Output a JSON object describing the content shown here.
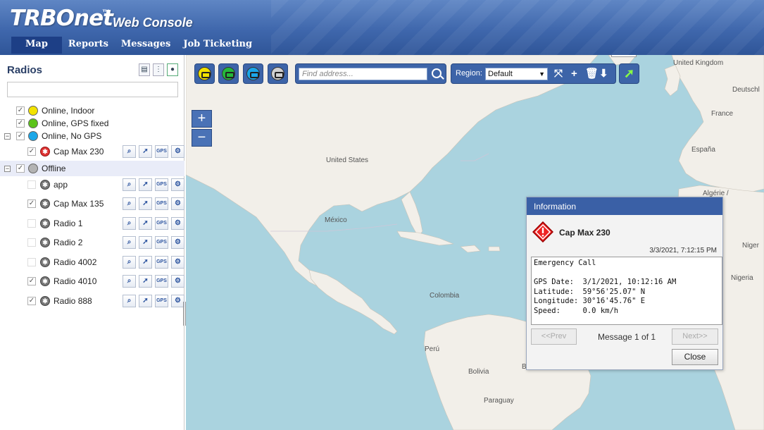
{
  "app": {
    "brand": "TRBOnet",
    "trademark": "™",
    "subtitle": "Web Console"
  },
  "nav": {
    "tabs": [
      {
        "label": "Map",
        "active": true
      },
      {
        "label": "Reports",
        "active": false
      },
      {
        "label": "Messages",
        "active": false
      },
      {
        "label": "Job Ticketing",
        "active": false
      }
    ]
  },
  "left_panel": {
    "title": "Radios",
    "filter_value": "",
    "groups": [
      {
        "label": "Online, Indoor",
        "color": "#f2e200",
        "checked": true
      },
      {
        "label": "Online, GPS fixed",
        "color": "#5cc31a",
        "checked": true
      },
      {
        "label": "Online, No GPS",
        "color": "#1ba7e8",
        "checked": true,
        "expanded": true
      },
      {
        "label": "Offline",
        "color": "#b3b3b3",
        "checked": true,
        "expanded": true
      }
    ],
    "radios": [
      {
        "label": "Cap Max 230",
        "checked": true
      },
      {
        "label": "app",
        "checked": false
      },
      {
        "label": "Cap Max 135",
        "checked": true
      },
      {
        "label": "Radio 1",
        "checked": false
      },
      {
        "label": "Radio 2",
        "checked": false
      },
      {
        "label": "Radio 4002",
        "checked": false
      },
      {
        "label": "Radio 4010",
        "checked": true
      },
      {
        "label": "Radio 888",
        "checked": true
      }
    ],
    "action_gps_label": "GPS"
  },
  "toolbar": {
    "search_placeholder": "Find address...",
    "region_label": "Region:",
    "region_value": "Default",
    "filter_colors": [
      "#f2e200",
      "#25b83a",
      "#1ba7e8",
      "#b3b3b3"
    ]
  },
  "map": {
    "labels": [
      "United Kingdom",
      "Deutschl",
      "France",
      "España",
      "Algérie /",
      "Niger",
      "Nigeria",
      "United States",
      "México",
      "Colombia",
      "Perú",
      "Bolivia",
      "Paraguay",
      "B"
    ]
  },
  "dialog": {
    "title": "Information",
    "radio_name": "Cap Max 230",
    "timestamp": "3/3/2021, 7:12:15 PM",
    "message": "Emergency Call\n\nGPS Date:  3/1/2021, 10:12:16 AM\nLatitude:  59°56'25.07\" N\nLongitude: 30°16'45.76\" E\nSpeed:     0.0 km/h",
    "prev_label": "<<Prev",
    "next_label": "Next>>",
    "page_text": "Message 1 of 1",
    "close_label": "Close"
  },
  "colors": {
    "header": "#3f67ac",
    "accent": "#3d64a8",
    "water": "#aad3df",
    "land": "#f2efe9"
  }
}
